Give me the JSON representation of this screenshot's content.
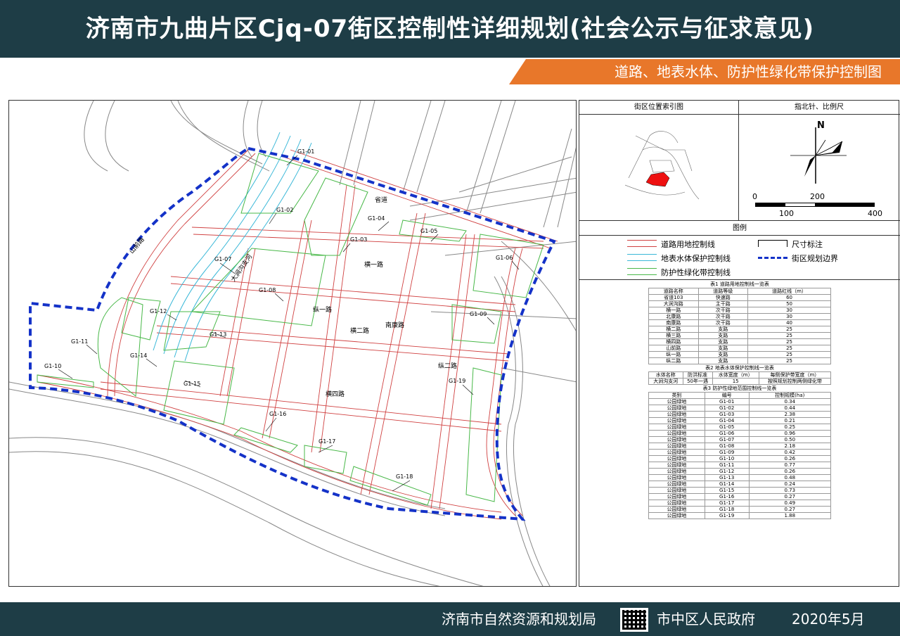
{
  "header": {
    "title": "济南市九曲片区Cjq-07街区控制性详细规划(社会公示与征求意见)"
  },
  "subheader": {
    "title": "道路、地表水体、防护性绿化带保护控制图"
  },
  "map": {
    "parcels": [
      "G1-01",
      "G1-02",
      "G1-03",
      "G1-04",
      "G1-05",
      "G1-06",
      "G1-07",
      "G1-08",
      "G1-09",
      "G1-10",
      "G1-11",
      "G1-12",
      "G1-13",
      "G1-14",
      "G1-15",
      "G1-16",
      "G1-17",
      "G1-18",
      "G1-19"
    ],
    "road_labels": [
      "横一路",
      "纵一路",
      "横二路",
      "南康路",
      "横四路",
      "纵二路",
      "省道",
      "大涧沟支河",
      "山前路"
    ],
    "colors": {
      "boundary": "#1432c8",
      "road_line": "#d04040",
      "water_line": "#3ab8d8",
      "green_line": "#48b848"
    }
  },
  "side": {
    "index_header": "街区位置索引图",
    "north_header": "指北针、比例尺",
    "north_letter": "N",
    "scale": {
      "top_labels": [
        "0",
        "200"
      ],
      "bottom_labels": [
        "100",
        "400"
      ]
    },
    "legend_header": "图例",
    "legend": [
      {
        "label": "道路用地控制线"
      },
      {
        "label": "尺寸标注"
      },
      {
        "label": "地表水体保护控制线"
      },
      {
        "label": "街区规划边界"
      },
      {
        "label": "防护性绿化带控制线"
      }
    ]
  },
  "table1": {
    "caption": "表1 道路用地控制线一览表",
    "headers": [
      "道路名称",
      "道路等级",
      "道路红线（m）"
    ],
    "rows": [
      [
        "省道103",
        "快速路",
        "60"
      ],
      [
        "大涧沟路",
        "主干路",
        "50"
      ],
      [
        "横一路",
        "次干路",
        "30"
      ],
      [
        "北康路",
        "次干路",
        "30"
      ],
      [
        "南康路",
        "次干路",
        "40"
      ],
      [
        "横二路",
        "支路",
        "25"
      ],
      [
        "横三路",
        "支路",
        "25"
      ],
      [
        "横四路",
        "支路",
        "25"
      ],
      [
        "山前路",
        "支路",
        "25"
      ],
      [
        "纵一路",
        "支路",
        "25"
      ],
      [
        "纵二路",
        "支路",
        "25"
      ]
    ]
  },
  "table2": {
    "caption": "表2 地表水体保护控制线一览表",
    "headers": [
      "水体名称",
      "防洪标准",
      "水体宽度（m）",
      "每侧保护带宽度（m）"
    ],
    "rows": [
      [
        "大涧沟支河",
        "50年一遇",
        "15",
        "按照规划控制两侧绿化带"
      ]
    ]
  },
  "table3": {
    "caption": "表3 防护性绿地范围控制线一览表",
    "headers": [
      "类别",
      "编号",
      "控制规模(ha)"
    ],
    "rows": [
      [
        "公园绿地",
        "G1-01",
        "0.34"
      ],
      [
        "公园绿地",
        "G1-02",
        "0.44"
      ],
      [
        "公园绿地",
        "G1-03",
        "2.38"
      ],
      [
        "公园绿地",
        "G1-04",
        "0.21"
      ],
      [
        "公园绿地",
        "G1-05",
        "0.25"
      ],
      [
        "公园绿地",
        "G1-06",
        "0.96"
      ],
      [
        "公园绿地",
        "G1-07",
        "0.50"
      ],
      [
        "公园绿地",
        "G1-08",
        "2.18"
      ],
      [
        "公园绿地",
        "G1-09",
        "0.42"
      ],
      [
        "公园绿地",
        "G1-10",
        "0.26"
      ],
      [
        "公园绿地",
        "G1-11",
        "0.77"
      ],
      [
        "公园绿地",
        "G1-12",
        "0.26"
      ],
      [
        "公园绿地",
        "G1-13",
        "0.48"
      ],
      [
        "公园绿地",
        "G1-14",
        "0.24"
      ],
      [
        "公园绿地",
        "G1-15",
        "0.73"
      ],
      [
        "公园绿地",
        "G1-16",
        "0.27"
      ],
      [
        "公园绿地",
        "G1-17",
        "0.49"
      ],
      [
        "公园绿地",
        "G1-18",
        "0.27"
      ],
      [
        "公园绿地",
        "G1-19",
        "1.88"
      ]
    ]
  },
  "footer": {
    "org1": "济南市自然资源和规划局",
    "org2": "市中区人民政府",
    "date": "2020年5月"
  }
}
